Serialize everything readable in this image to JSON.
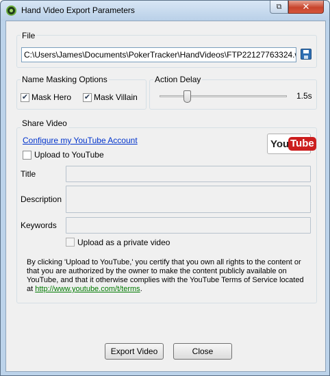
{
  "window": {
    "title": "Hand Video Export Parameters",
    "restore_glyph": "⧉",
    "close_glyph": "✕"
  },
  "file": {
    "label": "File",
    "path": "C:\\Users\\James\\Documents\\PokerTracker\\HandVideos\\FTP22127763324.w",
    "save_icon": "save-icon"
  },
  "masking": {
    "label": "Name Masking Options",
    "hero_label": "Mask Hero",
    "hero_checked": true,
    "villain_label": "Mask Villain",
    "villain_checked": true
  },
  "delay": {
    "label": "Action Delay",
    "value_text": "1.5s",
    "slider_fraction": 0.22
  },
  "share": {
    "label": "Share Video",
    "configure_link": "Configure my YouTube Account",
    "upload_label": "Upload to YouTube",
    "upload_checked": false,
    "youtube_logo": {
      "you": "You",
      "tube": "Tube"
    },
    "title_label": "Title",
    "description_label": "Description",
    "keywords_label": "Keywords",
    "private_label": "Upload as a private video",
    "terms_text": "By clicking 'Upload to YouTube,' you certify that you own all rights to the content or that you are authorized by the owner to make the content publicly available on YouTube, and that it otherwise complies with the YouTube Terms of Service located at ",
    "terms_link": "http://www.youtube.com/t/terms",
    "terms_end": "."
  },
  "buttons": {
    "export": "Export Video",
    "close": "Close"
  },
  "colors": {
    "accent": "#0033cc",
    "youtube_red": "#cc1e1e",
    "terms_link": "#007a00"
  }
}
